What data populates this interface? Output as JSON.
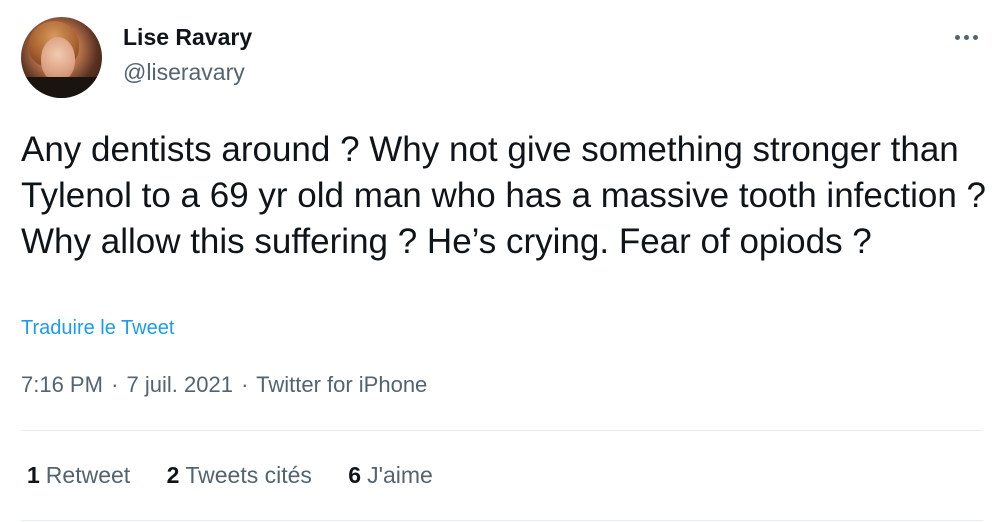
{
  "author": {
    "name": "Lise Ravary",
    "handle": "@liseravary"
  },
  "tweet": {
    "text": "Any dentists around ? Why not give something stronger than Tylenol to a 69 yr old man who has a massive tooth infection ? Why allow this suffering ? He’s crying. Fear of opiods ?",
    "translate_label": "Traduire le Tweet",
    "time": "7:16 PM",
    "date": "7 juil. 2021",
    "source": "Twitter for iPhone",
    "separator": "·"
  },
  "stats": [
    {
      "count": "1",
      "label": "Retweet"
    },
    {
      "count": "2",
      "label": "Tweets cités"
    },
    {
      "count": "6",
      "label": "J'aime"
    }
  ],
  "colors": {
    "link": "#1d9bf0",
    "secondary_text": "#536471",
    "primary_text": "#0f1419",
    "divider": "#e6ecf0"
  },
  "icons": {
    "more": "more-horizontal-icon",
    "avatar": "profile-photo"
  }
}
